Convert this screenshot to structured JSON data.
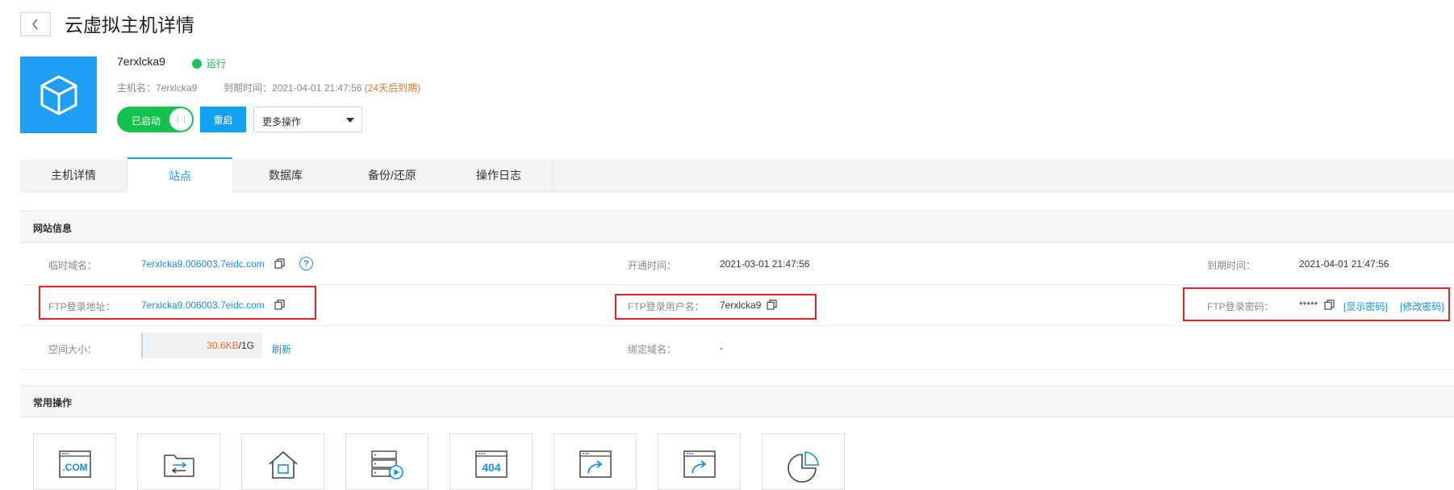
{
  "header": {
    "title": "云虚拟主机详情"
  },
  "host": {
    "name": "7erxlcka9",
    "status": "运行",
    "meta_host_label": "主机名：",
    "meta_host_value": "7erxlcka9",
    "meta_expire_label": "到期时间：",
    "meta_expire_value": "2021-04-01 21:47:56",
    "meta_expire_warn": "(24天后到期)"
  },
  "actions": {
    "toggle_label": "已启动",
    "restart_label": "重启",
    "more_label": "更多操作"
  },
  "tabs": [
    {
      "label": "主机详情"
    },
    {
      "label": "站点"
    },
    {
      "label": "数据库"
    },
    {
      "label": "备份/还原"
    },
    {
      "label": "操作日志"
    }
  ],
  "site_info": {
    "section_title": "网站信息",
    "temp_domain_label": "临时域名：",
    "temp_domain_value": "7erxlcka9.006003.7eidc.com",
    "open_time_label": "开通时间：",
    "open_time_value": "2021-03-01 21:47:56",
    "expire_label": "到期时间：",
    "expire_value": "2021-04-01 21:47:56",
    "ftp_addr_label": "FTP登录地址：",
    "ftp_addr_value": "7erxlcka9.006003.7eidc.com",
    "ftp_user_label": "FTP登录用户名：",
    "ftp_user_value": "7erxlcka9",
    "ftp_pwd_label": "FTP登录密码：",
    "ftp_pwd_value": "*****",
    "show_pwd_link": "[显示密码]",
    "change_pwd_link": "[修改密码]",
    "space_label": "空间大小：",
    "space_used": "30.6KB",
    "space_total": "/1G",
    "refresh_link": "刷新",
    "bind_domain_label": "绑定域名：",
    "bind_domain_value": "-"
  },
  "common_ops": {
    "section_title": "常用操作",
    "tile_icons": [
      "com-icon",
      "transfer-icon",
      "home-icon",
      "server-play-icon",
      "404-icon",
      "redirect-icon",
      "redirect-icon",
      "pie-chart-icon"
    ],
    "com_text": ".COM",
    "code_404": "404"
  },
  "colors": {
    "accent": "#11a0f2",
    "success": "#15c24f",
    "warning": "#f0722b",
    "highlight_box": "#e02424"
  }
}
